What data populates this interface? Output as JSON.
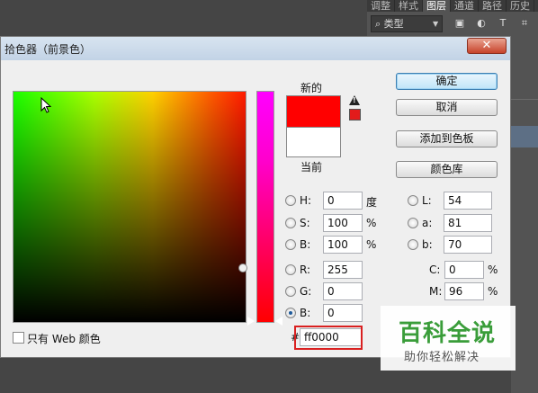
{
  "ps": {
    "tabs": [
      "调整",
      "样式",
      "图层",
      "通道",
      "路径",
      "历史"
    ],
    "active_tab": "图层",
    "kind_label": "类型",
    "icons": [
      "image-filter-icon",
      "adjustment-filter-icon",
      "type-filter-icon",
      "shape-filter-icon"
    ]
  },
  "dialog": {
    "title": "拾色器（前景色）",
    "close_label": "✕",
    "new_label": "新的",
    "current_label": "当前",
    "new_color": "#ff0000",
    "current_color": "#ffffff",
    "buttons": {
      "ok": "确定",
      "cancel": "取消",
      "add_swatch": "添加到色板",
      "libraries": "颜色库"
    },
    "hsb": [
      {
        "label": "H:",
        "value": "0",
        "unit": "度"
      },
      {
        "label": "S:",
        "value": "100",
        "unit": "%"
      },
      {
        "label": "B:",
        "value": "100",
        "unit": "%"
      }
    ],
    "rgb": [
      {
        "label": "R:",
        "value": "255"
      },
      {
        "label": "G:",
        "value": "0"
      },
      {
        "label": "B:",
        "value": "0"
      }
    ],
    "lab": [
      {
        "label": "L:",
        "value": "54"
      },
      {
        "label": "a:",
        "value": "81"
      },
      {
        "label": "b:",
        "value": "70"
      }
    ],
    "cmyk": [
      {
        "label": "C:",
        "value": "0",
        "unit": "%"
      },
      {
        "label": "M:",
        "value": "96",
        "unit": "%"
      }
    ],
    "web_only_label": "只有 Web 颜色",
    "hash": "#",
    "hex": "ff0000"
  },
  "watermark": {
    "title": "百科全说",
    "subtitle": "助你轻松解决"
  }
}
